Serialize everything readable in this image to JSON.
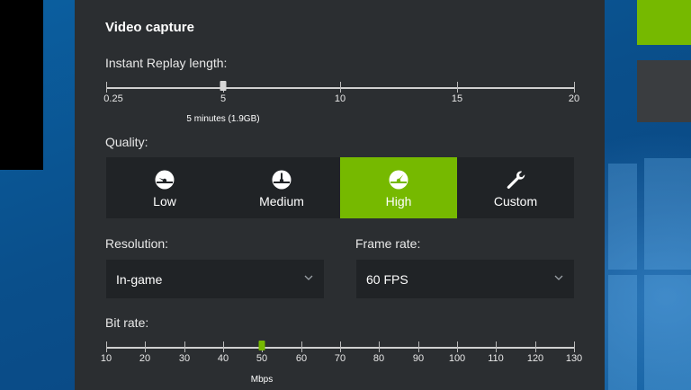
{
  "panel": {
    "title": "Video capture",
    "replay": {
      "label": "Instant Replay length:",
      "ticks": [
        "0.25",
        "5",
        "10",
        "15",
        "20"
      ],
      "value_minutes": 5,
      "caption": "5 minutes (1.9GB)"
    },
    "quality": {
      "label": "Quality:",
      "options": [
        {
          "label": "Low",
          "icon": "gauge-low-icon"
        },
        {
          "label": "Medium",
          "icon": "gauge-medium-icon"
        },
        {
          "label": "High",
          "icon": "gauge-high-icon"
        },
        {
          "label": "Custom",
          "icon": "wrench-icon"
        }
      ],
      "selected": "High"
    },
    "resolution": {
      "label": "Resolution:",
      "value": "In-game"
    },
    "frame_rate": {
      "label": "Frame rate:",
      "value": "60 FPS"
    },
    "bitrate": {
      "label": "Bit rate:",
      "ticks": [
        "10",
        "20",
        "30",
        "40",
        "50",
        "60",
        "70",
        "80",
        "90",
        "100",
        "110",
        "120",
        "130"
      ],
      "value": 50,
      "unit": "Mbps"
    }
  },
  "colors": {
    "accent": "#76b900",
    "panel_bg": "#2b2e31",
    "control_bg": "#202326"
  }
}
